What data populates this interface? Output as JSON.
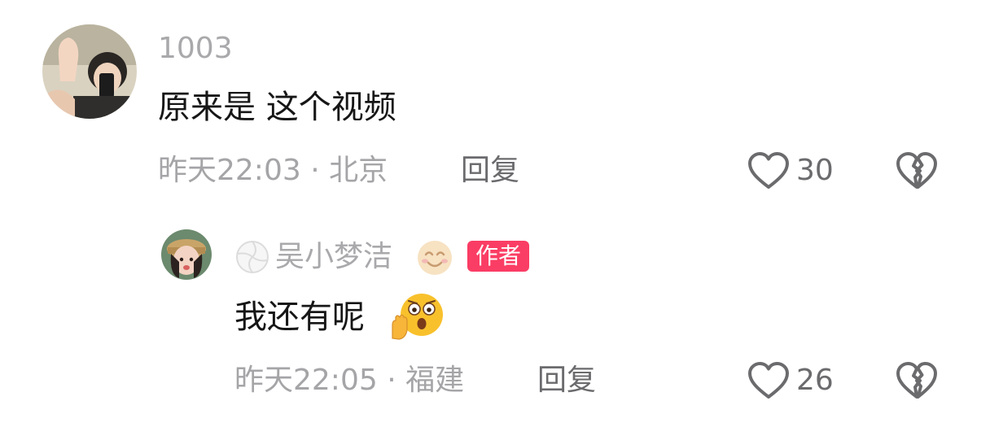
{
  "comment": {
    "username": "1003",
    "text": "原来是 这个视频",
    "time_location": "昨天22:03 · 北京",
    "reply_label": "回复",
    "like_count": "30",
    "icons": {
      "like": "heart-outline-icon",
      "dislike": "broken-heart-icon"
    }
  },
  "reply": {
    "username": "吴小梦洁",
    "author_badge": "作者",
    "text": "我还有呢",
    "time_location": "昨天22:05 · 福建",
    "reply_label": "回复",
    "like_count": "26",
    "icons": {
      "username_prefix": "volleyball-icon",
      "username_suffix": "smiling-face-emoji",
      "text_suffix": "shocked-face-emoji",
      "like": "heart-outline-icon",
      "dislike": "broken-heart-icon"
    }
  },
  "colors": {
    "badge": "#fa3d64",
    "muted_text": "#a5a5a8",
    "body_text": "#161616"
  }
}
